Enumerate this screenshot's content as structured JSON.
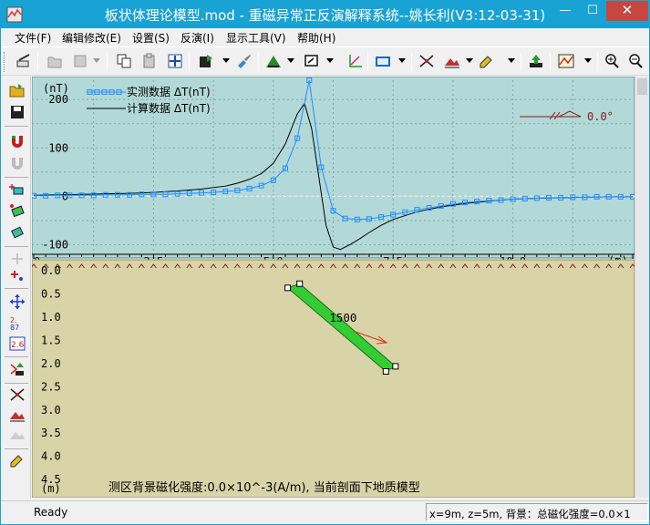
{
  "window": {
    "title": "板状体理论模型.mod - 重磁异常正反演解释系统--姚长利(V3:12-03-31)",
    "minimize": "—",
    "maximize": "☐",
    "close": "✕"
  },
  "menu": {
    "items": [
      {
        "label": "文件(F)"
      },
      {
        "label": "编辑修改(E)"
      },
      {
        "label": "设置(S)"
      },
      {
        "label": "反演(I)"
      },
      {
        "label": "显示工具(V)"
      },
      {
        "label": "帮助(H)"
      }
    ]
  },
  "toolbar_icons": [
    "edit-icon",
    "open-gray-icon",
    "save-gray-icon",
    "copy-icon",
    "paste-icon",
    "zoom-fit-icon",
    "export-icon",
    "brush-icon",
    "mountain-icon",
    "screen-icon",
    "axis-icon",
    "window-icon",
    "network-icon",
    "mountain-pen-icon",
    "pen-icon",
    "upload-icon",
    "chart-icon",
    "zoom-in-icon",
    "zoom-out-icon"
  ],
  "lefttoolbar_icons": [
    "open-icon",
    "save-icon",
    "magnet-icon",
    "magnet-gray-icon",
    "block-add-icon",
    "block-move-icon",
    "block-edit-icon",
    "point-gray-icon",
    "point-add-icon",
    "axis-move-icon",
    "param-icon",
    "param-box-icon",
    "export-icon",
    "network-icon",
    "mountain-icon",
    "grid-gray-icon",
    "pen-icon"
  ],
  "chart_data": {
    "type": "line",
    "top_panel": {
      "y_unit_label": "(nT)",
      "x_unit_label": "(m)",
      "x_ticks": [
        "0",
        "2.5",
        "5.0",
        "7.5",
        "10.0"
      ],
      "x_tick_values": [
        0,
        2.5,
        5.0,
        7.5,
        10.0
      ],
      "y_ticks": [
        "200",
        "100",
        "0",
        "-100"
      ],
      "y_tick_values": [
        200,
        100,
        0,
        -100
      ],
      "xlim": [
        0,
        12.5
      ],
      "ylim": [
        -120,
        240
      ],
      "legend": [
        {
          "label": "实测数据  ΔT(nT)",
          "style": "line-with-square-markers",
          "color": "#1e90ff"
        },
        {
          "label": "计算数据  ΔT(nT)",
          "style": "line",
          "color": "#000000"
        }
      ],
      "annotation": "0.0°",
      "series": [
        {
          "name": "实测数据  ΔT(nT)",
          "color": "#1e90ff",
          "x": [
            0,
            0.25,
            0.5,
            0.75,
            1.0,
            1.25,
            1.5,
            1.75,
            2.0,
            2.25,
            2.5,
            2.75,
            3.0,
            3.25,
            3.5,
            3.75,
            4.0,
            4.25,
            4.5,
            4.75,
            5.0,
            5.25,
            5.5,
            5.75,
            6.0,
            6.25,
            6.5,
            6.75,
            7.0,
            7.25,
            7.5,
            7.75,
            8.0,
            8.25,
            8.5,
            8.75,
            9.0,
            9.25,
            9.5,
            9.75,
            10.0,
            10.25,
            10.5,
            10.75,
            11.0,
            11.25,
            11.5,
            11.75,
            12.0,
            12.25,
            12.5
          ],
          "y": [
            1,
            1,
            2,
            2,
            2,
            2,
            3,
            3,
            3,
            4,
            4,
            4,
            5,
            6,
            7,
            8,
            10,
            12,
            16,
            22,
            33,
            58,
            120,
            245,
            60,
            -30,
            -46,
            -48,
            -47,
            -43,
            -38,
            -33,
            -28,
            -24,
            -20,
            -16,
            -13,
            -11,
            -9,
            -8,
            -6,
            -5,
            -4,
            -3,
            -3,
            -2,
            -2,
            -1,
            -1,
            -1,
            -1
          ]
        },
        {
          "name": "计算数据  ΔT(nT)",
          "color": "#000000",
          "x": [
            0,
            0.5,
            1.0,
            1.5,
            2.0,
            2.5,
            3.0,
            3.5,
            4.0,
            4.25,
            4.5,
            4.75,
            5.0,
            5.25,
            5.5,
            5.65,
            5.8,
            5.95,
            6.1,
            6.25,
            6.4,
            6.6,
            6.8,
            7.0,
            7.25,
            7.5,
            8.0,
            8.5,
            9.0,
            9.5,
            10.0,
            10.5,
            11.0,
            11.5,
            12.0,
            12.5
          ],
          "y": [
            2,
            3,
            4,
            5,
            6,
            8,
            11,
            15,
            21,
            27,
            35,
            47,
            68,
            108,
            170,
            192,
            140,
            40,
            -60,
            -105,
            -110,
            -100,
            -88,
            -75,
            -60,
            -48,
            -32,
            -22,
            -15,
            -10,
            -6,
            -4,
            -3,
            -2,
            -1,
            -1
          ]
        }
      ]
    },
    "bottom_panel": {
      "y_unit_label": "(m)",
      "y_ticks": [
        "0.0",
        "0.5",
        "1.0",
        "1.5",
        "2.0",
        "2.5",
        "3.0",
        "3.5",
        "4.0",
        "4.5"
      ],
      "y_tick_values": [
        0.0,
        0.5,
        1.0,
        1.5,
        2.0,
        2.5,
        3.0,
        3.5,
        4.0,
        4.5
      ],
      "ylim": [
        0,
        4.85
      ],
      "xlim": [
        0,
        12.5
      ],
      "body": {
        "label": "1500",
        "color": "#33cc33",
        "corners": [
          [
            5.3,
            0.37
          ],
          [
            5.55,
            0.28
          ],
          [
            7.55,
            2.06
          ],
          [
            7.35,
            2.17
          ]
        ]
      },
      "caption": "测区背景磁化强度:0.0×10^-3(A/m), 当前剖面下地质模型"
    }
  },
  "status": {
    "left": "Ready",
    "right": "x=9m, z=5m, 背景：总磁化强度=0.0×1"
  },
  "colors": {
    "title_bar": "#19a2d4",
    "top_panel_bg": "#b2d8d8",
    "bottom_panel_bg": "#d8d4a8",
    "measured": "#1e90ff",
    "computed": "#000000",
    "body": "#33cc33",
    "magnetization_arrow": "#e03020"
  }
}
